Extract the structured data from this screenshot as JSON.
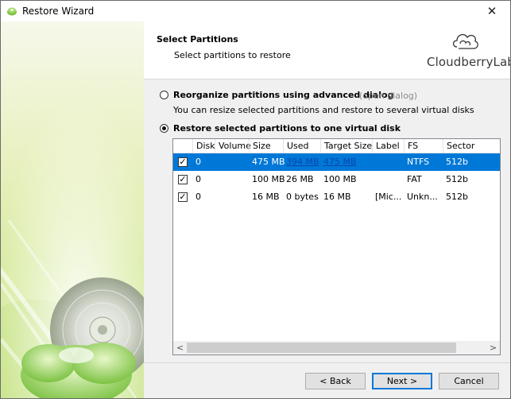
{
  "window": {
    "title": "Restore Wizard",
    "close_glyph": "✕"
  },
  "header": {
    "title": "Select Partitions",
    "subtitle": "Select partitions to restore",
    "logo_text": "CloudberryLab"
  },
  "options": [
    {
      "label": "Reorganize partitions using advanced dialog",
      "selected": false,
      "link": "(open dialog)",
      "description": "You can resize selected partitions and restore to several virtual disks"
    },
    {
      "label": "Restore selected partitions to one virtual disk",
      "selected": true
    }
  ],
  "table": {
    "columns": [
      "Disk",
      "Volume",
      "Size",
      "Used",
      "Target Size",
      "Label",
      "FS",
      "Sector"
    ],
    "rows": [
      {
        "checked": true,
        "disk": "0",
        "volume": "",
        "size": "475 MB",
        "used": "394 MB",
        "target_size": "475 MB",
        "label": "",
        "fs": "NTFS",
        "sector": "512b",
        "selected": true
      },
      {
        "checked": true,
        "disk": "0",
        "volume": "",
        "size": "100 MB",
        "used": "26 MB",
        "target_size": "100 MB",
        "label": "",
        "fs": "FAT",
        "sector": "512b",
        "selected": false
      },
      {
        "checked": true,
        "disk": "0",
        "volume": "",
        "size": "16 MB",
        "used": "0 bytes",
        "target_size": "16 MB",
        "label": "[Mic...",
        "fs": "Unkn...",
        "sector": "512b",
        "selected": false
      }
    ],
    "scroll_left": "<",
    "scroll_right": ">"
  },
  "buttons": {
    "back": "< Back",
    "next": "Next >",
    "cancel": "Cancel"
  },
  "colors": {
    "selection": "#0078d7",
    "side_panel": "#eef3c6"
  }
}
